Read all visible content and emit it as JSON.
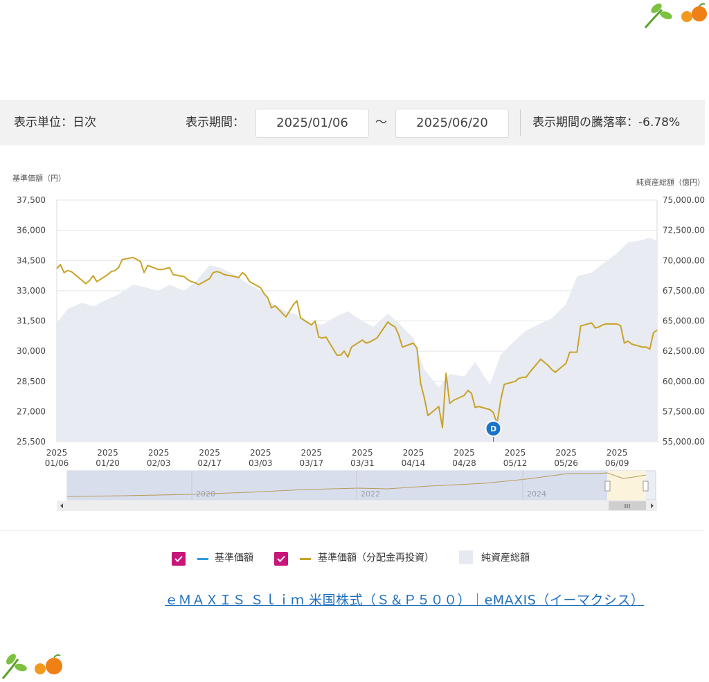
{
  "toolbar": {
    "unit_label": "表示単位：日次",
    "period_label": "表示期間：",
    "start_date": "2025/01/06",
    "tilde": "～",
    "end_date": "2025/06/20",
    "change_label": "表示期間の騰落率：-6.78%"
  },
  "legend": {
    "item1": "基準価額",
    "item2": "基準価額（分配金再投資）",
    "item3": "純資産総額"
  },
  "link_text": "ｅＭＡＸＩＳ Ｓｌｉｍ 米国株式（Ｓ＆Ｐ５００）｜eMAXIS（イーマクシス）",
  "marker_label": "D",
  "navigator_years": [
    "2020",
    "2022",
    "2024"
  ],
  "colors": {
    "price_line": "#c9a227",
    "base_line": "#2e9be0",
    "assets_area": "#e8ebf2",
    "checkbox": "#c8157a",
    "link": "#1f6fbf",
    "marker": "#1a73c8"
  },
  "chart_data": {
    "type": "line",
    "title": "",
    "ylabel": "基準価額（円）",
    "y2label": "純資産総額（億円）",
    "ylim": [
      25500,
      37500
    ],
    "y2lim": [
      55000,
      75000
    ],
    "yticks": [
      "37,500",
      "36,000",
      "34,500",
      "33,000",
      "31,500",
      "30,000",
      "28,500",
      "27,000",
      "25,500"
    ],
    "y2ticks": [
      "75,000.00",
      "72,500.00",
      "70,000.00",
      "67,500.00",
      "65,000.00",
      "62,500.00",
      "60,000.00",
      "57,500.00",
      "55,000.00"
    ],
    "xticks": [
      [
        "2025",
        "01/06"
      ],
      [
        "2025",
        "01/20"
      ],
      [
        "2025",
        "02/03"
      ],
      [
        "2025",
        "02/17"
      ],
      [
        "2025",
        "03/03"
      ],
      [
        "2025",
        "03/17"
      ],
      [
        "2025",
        "03/31"
      ],
      [
        "2025",
        "04/14"
      ],
      [
        "2025",
        "04/28"
      ],
      [
        "2025",
        "05/12"
      ],
      [
        "2025",
        "05/26"
      ],
      [
        "2025",
        "06/09"
      ]
    ],
    "x_start": "2025-01-06",
    "x_end": "2025-06-20",
    "series": [
      {
        "name": "基準価額（分配金再投資）",
        "points": [
          [
            "2025-01-06",
            34100
          ],
          [
            "2025-01-07",
            34300
          ],
          [
            "2025-01-08",
            33900
          ],
          [
            "2025-01-09",
            34000
          ],
          [
            "2025-01-10",
            33950
          ],
          [
            "2025-01-13",
            33500
          ],
          [
            "2025-01-14",
            33350
          ],
          [
            "2025-01-15",
            33500
          ],
          [
            "2025-01-16",
            33750
          ],
          [
            "2025-01-17",
            33450
          ],
          [
            "2025-01-20",
            33800
          ],
          [
            "2025-01-21",
            33950
          ],
          [
            "2025-01-22",
            34000
          ],
          [
            "2025-01-23",
            34150
          ],
          [
            "2025-01-24",
            34550
          ],
          [
            "2025-01-27",
            34650
          ],
          [
            "2025-01-28",
            34550
          ],
          [
            "2025-01-29",
            34450
          ],
          [
            "2025-01-30",
            33900
          ],
          [
            "2025-01-31",
            34250
          ],
          [
            "2025-02-03",
            34050
          ],
          [
            "2025-02-04",
            34050
          ],
          [
            "2025-02-05",
            34100
          ],
          [
            "2025-02-06",
            34150
          ],
          [
            "2025-02-07",
            33800
          ],
          [
            "2025-02-10",
            33700
          ],
          [
            "2025-02-11",
            33550
          ],
          [
            "2025-02-12",
            33450
          ],
          [
            "2025-02-13",
            33400
          ],
          [
            "2025-02-14",
            33300
          ],
          [
            "2025-02-17",
            33600
          ],
          [
            "2025-02-18",
            33900
          ],
          [
            "2025-02-19",
            33950
          ],
          [
            "2025-02-20",
            33900
          ],
          [
            "2025-02-21",
            33800
          ],
          [
            "2025-02-24",
            33700
          ],
          [
            "2025-02-25",
            33650
          ],
          [
            "2025-02-26",
            33900
          ],
          [
            "2025-02-27",
            33750
          ],
          [
            "2025-02-28",
            33450
          ],
          [
            "2025-03-03",
            33150
          ],
          [
            "2025-03-04",
            32850
          ],
          [
            "2025-03-05",
            32650
          ],
          [
            "2025-03-06",
            32150
          ],
          [
            "2025-03-07",
            32250
          ],
          [
            "2025-03-10",
            31700
          ],
          [
            "2025-03-11",
            32000
          ],
          [
            "2025-03-12",
            32300
          ],
          [
            "2025-03-13",
            32500
          ],
          [
            "2025-03-14",
            31650
          ],
          [
            "2025-03-17",
            31300
          ],
          [
            "2025-03-18",
            31500
          ],
          [
            "2025-03-19",
            30700
          ],
          [
            "2025-03-20",
            30650
          ],
          [
            "2025-03-21",
            30700
          ],
          [
            "2025-03-24",
            29800
          ],
          [
            "2025-03-25",
            29800
          ],
          [
            "2025-03-26",
            30000
          ],
          [
            "2025-03-27",
            29700
          ],
          [
            "2025-03-28",
            30200
          ],
          [
            "2025-03-31",
            30550
          ],
          [
            "2025-04-01",
            30400
          ],
          [
            "2025-04-02",
            30450
          ],
          [
            "2025-04-03",
            30550
          ],
          [
            "2025-04-04",
            30650
          ],
          [
            "2025-04-07",
            31450
          ],
          [
            "2025-04-08",
            31300
          ],
          [
            "2025-04-09",
            31200
          ],
          [
            "2025-04-10",
            30800
          ],
          [
            "2025-04-11",
            30200
          ],
          [
            "2025-04-14",
            30400
          ],
          [
            "2025-04-15",
            30150
          ],
          [
            "2025-04-16",
            28400
          ],
          [
            "2025-04-17",
            27700
          ],
          [
            "2025-04-18",
            26800
          ],
          [
            "2025-04-21",
            27250
          ],
          [
            "2025-04-22",
            26200
          ],
          [
            "2025-04-23",
            28900
          ],
          [
            "2025-04-24",
            27400
          ],
          [
            "2025-04-25",
            27550
          ],
          [
            "2025-04-28",
            27800
          ],
          [
            "2025-04-29",
            28050
          ],
          [
            "2025-04-30",
            27900
          ],
          [
            "2025-05-01",
            27200
          ],
          [
            "2025-05-02",
            27250
          ],
          [
            "2025-05-05",
            27100
          ],
          [
            "2025-05-06",
            26950
          ],
          [
            "2025-05-07",
            26400
          ],
          [
            "2025-05-08",
            27550
          ],
          [
            "2025-05-09",
            28350
          ],
          [
            "2025-05-12",
            28500
          ],
          [
            "2025-05-13",
            28650
          ],
          [
            "2025-05-14",
            28700
          ],
          [
            "2025-05-15",
            28700
          ],
          [
            "2025-05-16",
            28950
          ],
          [
            "2025-05-19",
            29600
          ],
          [
            "2025-05-20",
            29450
          ],
          [
            "2025-05-21",
            29300
          ],
          [
            "2025-05-22",
            29100
          ],
          [
            "2025-05-23",
            28950
          ],
          [
            "2025-05-26",
            29400
          ],
          [
            "2025-05-27",
            29950
          ],
          [
            "2025-05-28",
            29950
          ],
          [
            "2025-05-29",
            29950
          ],
          [
            "2025-05-30",
            31250
          ],
          [
            "2025-06-02",
            31400
          ],
          [
            "2025-06-03",
            31150
          ],
          [
            "2025-06-04",
            31200
          ],
          [
            "2025-06-05",
            31300
          ],
          [
            "2025-06-06",
            31350
          ],
          [
            "2025-06-09",
            31350
          ],
          [
            "2025-06-10",
            31250
          ],
          [
            "2025-06-11",
            30400
          ],
          [
            "2025-06-12",
            30500
          ],
          [
            "2025-06-13",
            30350
          ],
          [
            "2025-06-16",
            30200
          ],
          [
            "2025-06-17",
            30200
          ],
          [
            "2025-06-18",
            30100
          ],
          [
            "2025-06-19",
            30900
          ],
          [
            "2025-06-20",
            31050
          ]
        ]
      },
      {
        "name": "純資産総額",
        "axis": "right",
        "points": [
          [
            "2025-01-06",
            64800
          ],
          [
            "2025-01-09",
            66000
          ],
          [
            "2025-01-13",
            66500
          ],
          [
            "2025-01-16",
            66200
          ],
          [
            "2025-01-20",
            66800
          ],
          [
            "2025-01-23",
            67200
          ],
          [
            "2025-01-27",
            68000
          ],
          [
            "2025-01-30",
            67800
          ],
          [
            "2025-02-03",
            67500
          ],
          [
            "2025-02-06",
            68000
          ],
          [
            "2025-02-10",
            67500
          ],
          [
            "2025-02-13",
            68200
          ],
          [
            "2025-02-17",
            69600
          ],
          [
            "2025-02-20",
            69400
          ],
          [
            "2025-02-24",
            68800
          ],
          [
            "2025-02-27",
            68200
          ],
          [
            "2025-03-03",
            67500
          ],
          [
            "2025-03-06",
            66500
          ],
          [
            "2025-03-10",
            65800
          ],
          [
            "2025-03-13",
            65500
          ],
          [
            "2025-03-17",
            64800
          ],
          [
            "2025-03-20",
            64700
          ],
          [
            "2025-03-24",
            65400
          ],
          [
            "2025-03-27",
            65800
          ],
          [
            "2025-03-31",
            65000
          ],
          [
            "2025-04-03",
            64500
          ],
          [
            "2025-04-07",
            65600
          ],
          [
            "2025-04-10",
            64800
          ],
          [
            "2025-04-14",
            63600
          ],
          [
            "2025-04-17",
            61000
          ],
          [
            "2025-04-21",
            59500
          ],
          [
            "2025-04-24",
            60600
          ],
          [
            "2025-04-28",
            60400
          ],
          [
            "2025-05-01",
            61600
          ],
          [
            "2025-05-05",
            59700
          ],
          [
            "2025-05-08",
            62200
          ],
          [
            "2025-05-12",
            63400
          ],
          [
            "2025-05-15",
            64200
          ],
          [
            "2025-05-19",
            64800
          ],
          [
            "2025-05-22",
            65200
          ],
          [
            "2025-05-26",
            66400
          ],
          [
            "2025-05-29",
            68700
          ],
          [
            "2025-06-02",
            69000
          ],
          [
            "2025-06-05",
            69700
          ],
          [
            "2025-06-09",
            70600
          ],
          [
            "2025-06-12",
            71500
          ],
          [
            "2025-06-16",
            71700
          ],
          [
            "2025-06-18",
            71900
          ],
          [
            "2025-06-20",
            71600
          ]
        ]
      }
    ],
    "annotation": {
      "x": "2025-05-06",
      "label": "D"
    },
    "grid": true,
    "legend_position": "bottom"
  }
}
